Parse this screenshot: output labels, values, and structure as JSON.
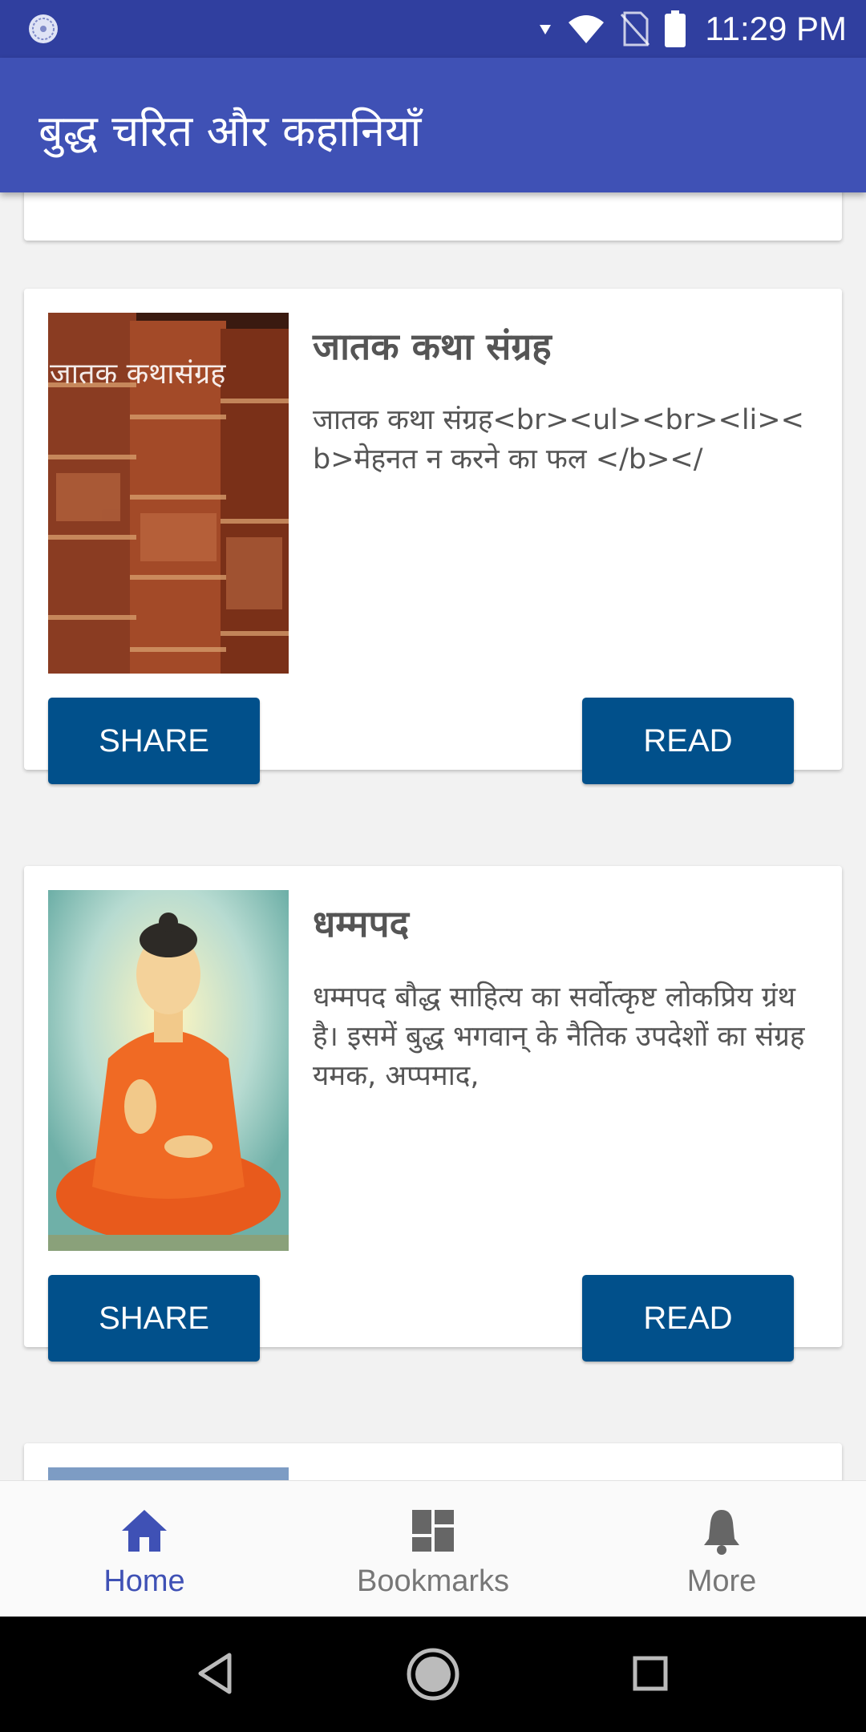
{
  "status_bar": {
    "time": "11:29 PM"
  },
  "app_bar": {
    "title": "बुद्ध चरित और कहानियाँ"
  },
  "cards": [
    {
      "title": "जातक कथा संग्रह",
      "description": "जातक कथा संग्रह<br><ul><br><li><b>मेहनत न करने का फल </b></",
      "image_caption": "जातक कथासंग्रह",
      "share_label": "SHARE",
      "read_label": "READ"
    },
    {
      "title": "धम्मपद",
      "description": "धम्मपद बौद्ध साहित्य का सर्वोत्कृष्ट लोकप्रिय ग्रंथ है। इसमें बुद्ध भगवान् के नैतिक उपदेशों का संग्रह यमक, अप्पमाद,",
      "share_label": "SHARE",
      "read_label": "READ"
    }
  ],
  "bottom_nav": {
    "items": [
      {
        "label": "Home",
        "icon": "home-icon",
        "active": true
      },
      {
        "label": "Bookmarks",
        "icon": "dashboard-icon",
        "active": false
      },
      {
        "label": "More",
        "icon": "bell-icon",
        "active": false
      }
    ]
  },
  "colors": {
    "status_bar": "#303f9f",
    "app_bar": "#3f51b5",
    "button": "#01508b",
    "active_nav": "#3f51b5"
  }
}
